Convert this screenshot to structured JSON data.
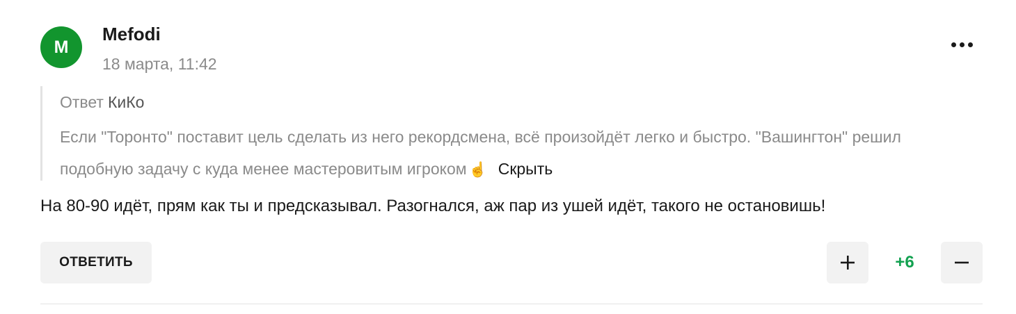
{
  "comment": {
    "avatar_letter": "M",
    "avatar_color": "#12952e",
    "author": "Mefodi",
    "timestamp": "18 марта, 11:42",
    "more_icon": "more-horizontal-icon",
    "quote": {
      "prefix": "Ответ",
      "author": "КиКо",
      "text": "Если \"Торонто\" поставит цель сделать из него рекордсмена, всё произойдёт легко и быстро. \"Вашингтон\" решил подобную задачу с куда менее мастеровитым игроком",
      "emoji": "☝",
      "emoji_icon": "pointing-finger-icon",
      "hide_label": "Скрыть"
    },
    "text": "На 80-90 идёт, прям как ты и предсказывал. Разогнался, аж пар из ушей идёт, такого не остановишь!",
    "actions": {
      "reply_label": "ОТВЕТИТЬ",
      "upvote_icon": "plus-icon",
      "downvote_icon": "minus-icon",
      "score": "+6",
      "score_color": "#12a150"
    }
  }
}
